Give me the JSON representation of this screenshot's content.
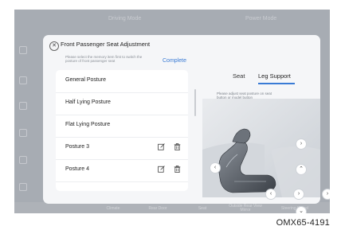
{
  "background": {
    "tab_left": "Driving Mode",
    "tab_right": "Power Mode",
    "bottom_bar": [
      "Climate",
      "Rear Door",
      "Seat",
      "Outside Rear View Mirror",
      "Steering Wheel"
    ]
  },
  "dialog": {
    "title": "Front Passenger Seat Adjustment",
    "hint": "Please select the memory item first to switch the posture of front passenger seat",
    "complete_label": "Complete",
    "postures": [
      {
        "label": "General Posture",
        "actions": false
      },
      {
        "label": "Half Lying Posture",
        "actions": false
      },
      {
        "label": "Flat Lying Posture",
        "actions": false
      },
      {
        "label": "Posture 3",
        "actions": true
      },
      {
        "label": "Posture 4",
        "actions": true
      }
    ],
    "tabs": {
      "seat": "Seat",
      "leg_support": "Leg Support",
      "active": "leg_support"
    },
    "seat_hint": "Please adjust seat posture on seat button or model button"
  },
  "caption": "OMX65-4191",
  "colors": {
    "accent": "#3a7bd5",
    "screen_bg": "#a7acb3",
    "dialog_bg": "#f5f6f8"
  }
}
